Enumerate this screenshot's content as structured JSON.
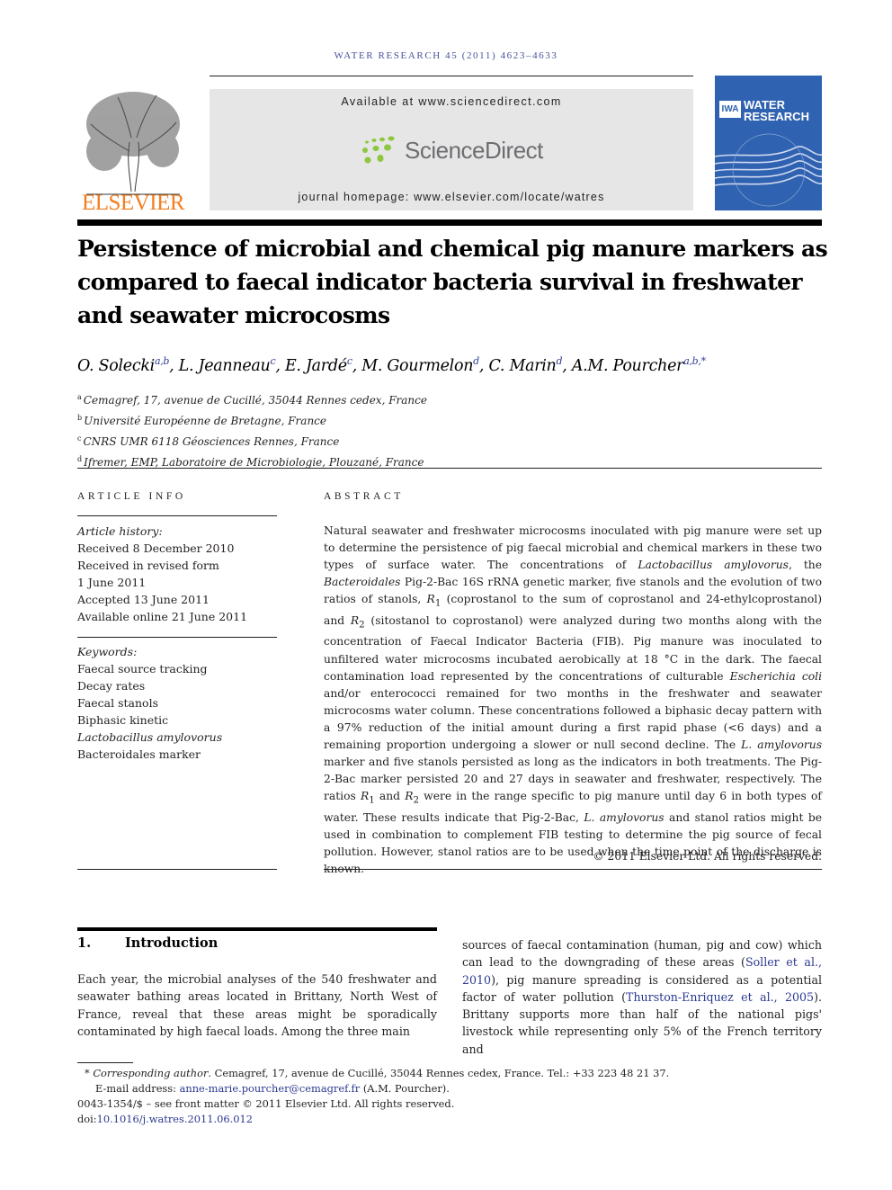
{
  "header": {
    "running_head": "WATER RESEARCH 45 (2011) 4623–4633",
    "publisher": "ELSEVIER",
    "available_at": "Available at www.sciencedirect.com",
    "platform_name": "ScienceDirect",
    "journal_homepage": "journal homepage: www.elsevier.com/locate/watres",
    "cover": {
      "org": "IWA",
      "line1": "WATER",
      "line2": "RESEARCH"
    },
    "colors": {
      "elsevier_orange": "#f47e20",
      "link_blue": "#2b3990",
      "cover_blue": "#2f62b0",
      "sd_green": "#8dc63f"
    }
  },
  "article": {
    "title": "Persistence of microbial and chemical pig manure markers as compared to faecal indicator bacteria survival in freshwater and seawater microcosms",
    "authors": [
      {
        "name": "O. Solecki",
        "aff": "a,b"
      },
      {
        "name": "L. Jeanneau",
        "aff": "c"
      },
      {
        "name": "E. Jardé",
        "aff": "c"
      },
      {
        "name": "M. Gourmelon",
        "aff": "d"
      },
      {
        "name": "C. Marin",
        "aff": "d"
      },
      {
        "name": "A.M. Pourcher",
        "aff": "a,b,*"
      }
    ],
    "affiliations": [
      {
        "key": "a",
        "text": "Cemagref, 17, avenue de Cucillé, 35044 Rennes cedex, France"
      },
      {
        "key": "b",
        "text": "Université Européenne de Bretagne, France"
      },
      {
        "key": "c",
        "text": "CNRS UMR 6118 Géosciences Rennes, France"
      },
      {
        "key": "d",
        "text": "Ifremer, EMP, Laboratoire de Microbiologie, Plouzané, France"
      }
    ]
  },
  "article_info": {
    "label": "ARTICLE INFO",
    "history_label": "Article history:",
    "history": [
      "Received 8 December 2010",
      "Received in revised form",
      "1 June 2011",
      "Accepted 13 June 2011",
      "Available online 21 June 2011"
    ],
    "keywords_label": "Keywords:",
    "keywords": [
      "Faecal source tracking",
      "Decay rates",
      "Faecal stanols",
      "Biphasic kinetic",
      "Lactobacillus amylovorus",
      "Bacteroidales marker"
    ]
  },
  "abstract": {
    "label": "ABSTRACT",
    "p1": "Natural seawater and freshwater microcosms inoculated with pig manure were set up to determine the persistence of pig faecal microbial and chemical markers in these two types of surface water. The concentrations of ",
    "sp1": "Lactobacillus amylovorus",
    "p2": ", the ",
    "sp2": "Bacteroidales",
    "p3": " Pig-2-Bac 16S rRNA genetic marker, five stanols and the evolution of two ratios of stanols, ",
    "r1": "R",
    "p4": " (coprostanol to the sum of coprostanol and 24-ethylcoprostanol) and ",
    "r2": "R",
    "p5": " (sitostanol to coprostanol) were analyzed during two months along with the concentration of Faecal Indicator Bacteria (FIB). Pig manure was inoculated to unfiltered water microcosms incubated aerobically at 18 °C in the dark. The faecal contamination load represented by the concentrations of culturable ",
    "sp3": "Escherichia coli",
    "p6": " and/or enterococci remained for two months in the freshwater and seawater microcosms water column. These concentrations followed a biphasic decay pattern with a 97% reduction of the initial amount during a first rapid phase (<6 days) and a remaining proportion undergoing a slower or null second decline. The ",
    "sp4": "L. amylovorus",
    "p7": " marker and five stanols persisted as long as the indicators in both treatments. The Pig-2-Bac marker persisted 20 and 27 days in seawater and freshwater, respectively. The ratios ",
    "p8": " and ",
    "p9": " were in the range specific to pig manure until day 6 in both types of water. These results indicate that Pig-2-Bac, ",
    "sp5": "L. amylovorus",
    "p10": " and stanol ratios might be used in combination to complement FIB testing to determine the pig source of fecal pollution. However, stanol ratios are to be used when the time point of the discharge is known.",
    "sub1": "1",
    "sub2": "2",
    "copyright": "© 2011 Elsevier Ltd. All rights reserved."
  },
  "intro": {
    "number": "1.",
    "heading": "Introduction",
    "left": "Each year, the microbial analyses of the 540 freshwater and seawater bathing areas located in Brittany, North West of France, reveal that these areas might be sporadically contaminated by high faecal loads. Among the three main",
    "right_a": "sources of faecal contamination (human, pig and cow) which can lead to the downgrading of these areas (",
    "cite1": "Soller et al., 2010",
    "right_b": "), pig manure spreading is considered as a potential factor of water pollution (",
    "cite2": "Thurston-Enriquez et al., 2005",
    "right_c": "). Brittany supports more than half of the national pigs' livestock while representing only 5% of the French territory and"
  },
  "footnotes": {
    "star": "*",
    "corr_label": "Corresponding author",
    "corr_text": ". Cemagref, 17, avenue de Cucillé, 35044 Rennes cedex, France. Tel.: +33 223 48 21 37.",
    "email_label": "E-mail address: ",
    "email": "anne-marie.pourcher@cemagref.fr",
    "email_after": " (A.M. Pourcher).",
    "issn": "0043-1354/$ – see front matter © 2011 Elsevier Ltd. All rights reserved.",
    "doi_label": "doi:",
    "doi": "10.1016/j.watres.2011.06.012"
  }
}
